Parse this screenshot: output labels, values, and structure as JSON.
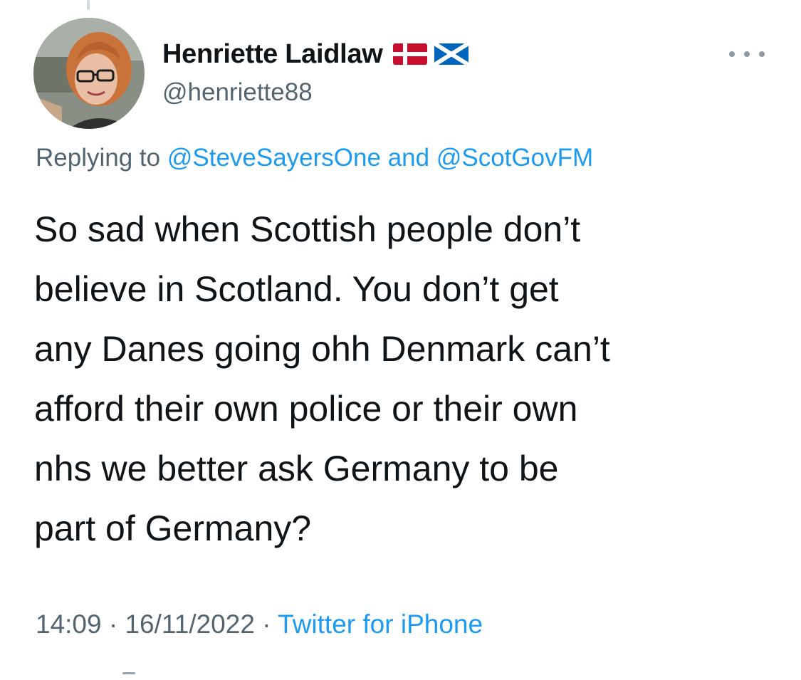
{
  "tweet": {
    "author": {
      "display_name": "Henriette Laidlaw",
      "handle": "@henriette88",
      "flags": [
        "denmark-flag-icon",
        "scotland-flag-icon"
      ]
    },
    "reply": {
      "prefix": "Replying to",
      "mention_1": "@SteveSayersOne",
      "conjunction": "and",
      "mention_2": "@ScotGovFM"
    },
    "text": "So sad when Scottish people don’t\nbelieve in Scotland. You don’t get\nany Danes going ohh Denmark can’t\nafford their own police or their own\nnhs we better ask Germany to be\npart of Germany?",
    "time": "14:09",
    "date": "16/11/2022",
    "separator": "·",
    "source": "Twitter for iPhone"
  },
  "colors": {
    "text": "#0f1419",
    "secondary": "#536471",
    "link": "#1d9bf0"
  }
}
